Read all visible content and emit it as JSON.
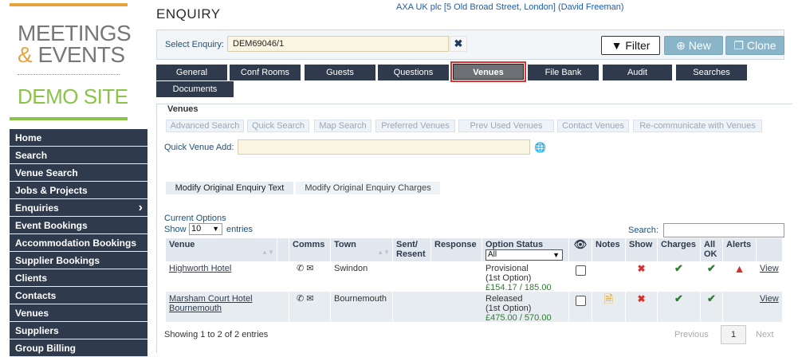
{
  "logo": {
    "line1": "MEETINGS",
    "amp": "&",
    "line2": "EVENTS",
    "demo": "DEMO SITE",
    "colors": {
      "orange": "#e8a33c",
      "green": "#8bc34a"
    }
  },
  "sidebar": {
    "items": [
      {
        "label": "Home"
      },
      {
        "label": "Search"
      },
      {
        "label": "Venue Search"
      },
      {
        "label": "Jobs & Projects"
      },
      {
        "label": "Enquiries",
        "chevron": "›"
      },
      {
        "label": "Event Bookings"
      },
      {
        "label": "Accommodation Bookings"
      },
      {
        "label": "Supplier Bookings"
      },
      {
        "label": "Clients"
      },
      {
        "label": "Contacts"
      },
      {
        "label": "Venues"
      },
      {
        "label": "Suppliers"
      },
      {
        "label": "Group Billing"
      }
    ]
  },
  "header": {
    "title": "ENQUIRY",
    "client_link": "AXA UK plc [5 Old Broad Street, London] (David Freeman)"
  },
  "enquiry_bar": {
    "label": "Select Enquiry:",
    "value": "DEM69046/1",
    "clear": "✖",
    "filter": "Filter",
    "new": "New",
    "clone": "Clone"
  },
  "tabs": [
    "General",
    "Conf Rooms",
    "Guests",
    "Questions",
    "Venues",
    "File Bank",
    "Audit",
    "Searches",
    "Documents"
  ],
  "venues_panel": {
    "legend": "Venues",
    "subtoolbar": [
      "Advanced Search",
      "Quick Search",
      "Map Search",
      "Preferred Venues",
      "Prev Used Venues",
      "Contact Venues",
      "Re-communicate with Venues"
    ],
    "quick_add_label": "Quick Venue Add:",
    "modify_text": "Modify Original Enquiry Text",
    "modify_charges": "Modify Original Enquiry Charges",
    "current_options": "Current Options",
    "show": "Show",
    "page_size": "10",
    "entries": "entries",
    "search": "Search:"
  },
  "table": {
    "headers": {
      "venue": "Venue",
      "comms": "Comms",
      "town": "Town",
      "sent": "Sent/ Resent",
      "response": "Response",
      "option_status": "Option Status",
      "notes": "Notes",
      "show": "Show",
      "charges": "Charges",
      "allok": "All OK",
      "alerts": "Alerts"
    },
    "status_filter": "All",
    "rows": [
      {
        "venue": "Highworth Hotel",
        "town": "Swindon",
        "status": "Provisional",
        "option": "(1st Option)",
        "price": "£154.17 / 185.00",
        "view": "View"
      },
      {
        "venue": "Marsham Court Hotel Bournemouth",
        "town": "Bournemouth",
        "status": "Released",
        "option": "(1st Option)",
        "price": "£475.00 / 570.00",
        "view": "View"
      }
    ]
  },
  "footer": {
    "showing": "Showing 1 to 2 of 2 entries",
    "previous": "Previous",
    "page": "1",
    "next": "Next"
  }
}
